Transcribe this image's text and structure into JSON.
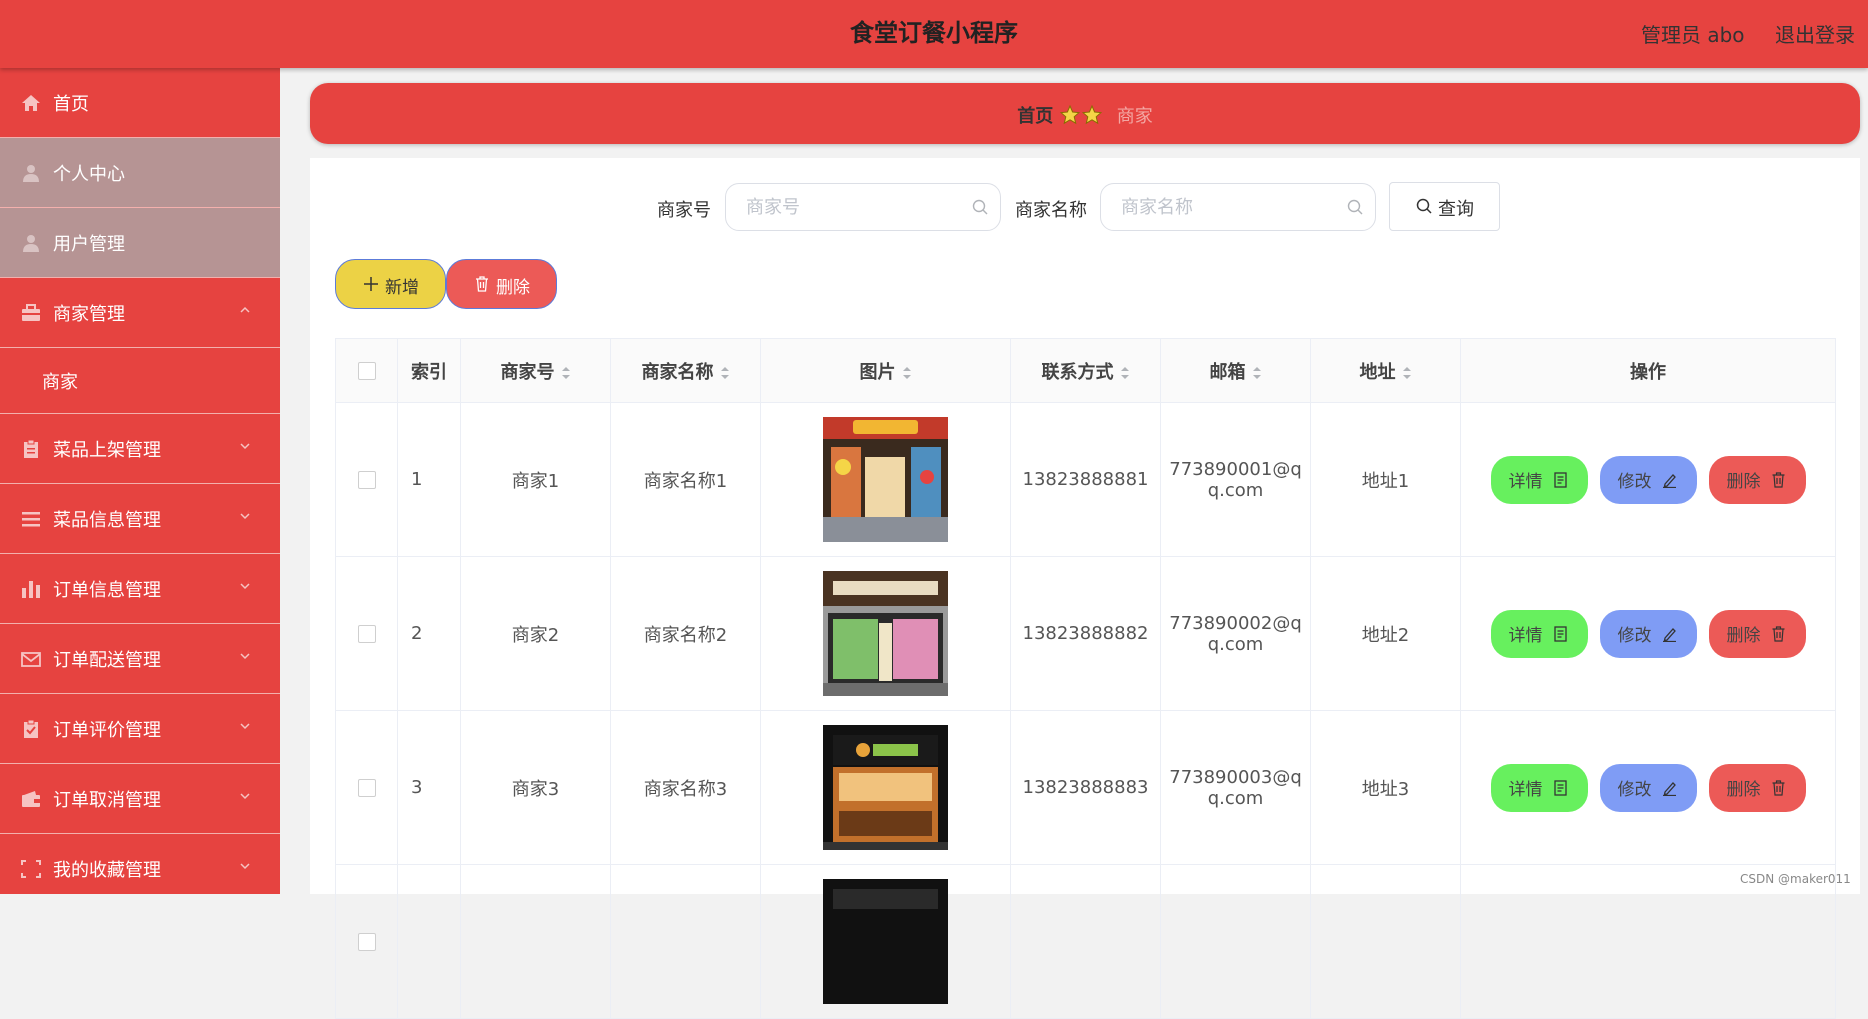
{
  "header": {
    "title": "食堂订餐小程序",
    "user": "管理员 abo",
    "logout": "退出登录"
  },
  "sidebar": {
    "items": [
      {
        "label": "首页",
        "icon": "home-icon"
      },
      {
        "label": "个人中心",
        "icon": "user-icon"
      },
      {
        "label": "用户管理",
        "icon": "user-icon"
      },
      {
        "label": "商家管理",
        "icon": "briefcase-icon",
        "expanded": true,
        "children": [
          {
            "label": "商家"
          }
        ]
      },
      {
        "label": "菜品上架管理",
        "icon": "clipboard-icon"
      },
      {
        "label": "菜品信息管理",
        "icon": "list-icon"
      },
      {
        "label": "订单信息管理",
        "icon": "bar-chart-icon"
      },
      {
        "label": "订单配送管理",
        "icon": "mail-icon"
      },
      {
        "label": "订单评价管理",
        "icon": "clipboard-check-icon"
      },
      {
        "label": "订单取消管理",
        "icon": "wallet-icon"
      },
      {
        "label": "我的收藏管理",
        "icon": "frame-icon"
      }
    ]
  },
  "breadcrumb": {
    "home": "首页",
    "current": "商家"
  },
  "search": {
    "merchant_no_label": "商家号",
    "merchant_no_placeholder": "商家号",
    "merchant_name_label": "商家名称",
    "merchant_name_placeholder": "商家名称",
    "query_button": "查询"
  },
  "toolbar": {
    "add": "新增",
    "delete": "删除"
  },
  "table": {
    "columns": [
      "索引",
      "商家号",
      "商家名称",
      "图片",
      "联系方式",
      "邮箱",
      "地址",
      "操作"
    ],
    "rows": [
      {
        "index": "1",
        "merchant_no": "商家1",
        "merchant_name": "商家名称1",
        "phone": "13823888881",
        "email_1": "773890001@q",
        "email_2": "q.com",
        "address": "地址1"
      },
      {
        "index": "2",
        "merchant_no": "商家2",
        "merchant_name": "商家名称2",
        "phone": "13823888882",
        "email_1": "773890002@q",
        "email_2": "q.com",
        "address": "地址2"
      },
      {
        "index": "3",
        "merchant_no": "商家3",
        "merchant_name": "商家名称3",
        "phone": "13823888883",
        "email_1": "773890003@q",
        "email_2": "q.com",
        "address": "地址3"
      }
    ],
    "row_actions": {
      "detail": "详情",
      "edit": "修改",
      "delete": "删除"
    }
  },
  "watermark": "CSDN @maker011",
  "colors": {
    "primary": "#e64340",
    "sidebar_grey": "#b69494",
    "add_button": "#ecd245",
    "delete_button": "#ec5a57",
    "detail_button": "#67f05e",
    "edit_button": "#7f9cf5"
  }
}
